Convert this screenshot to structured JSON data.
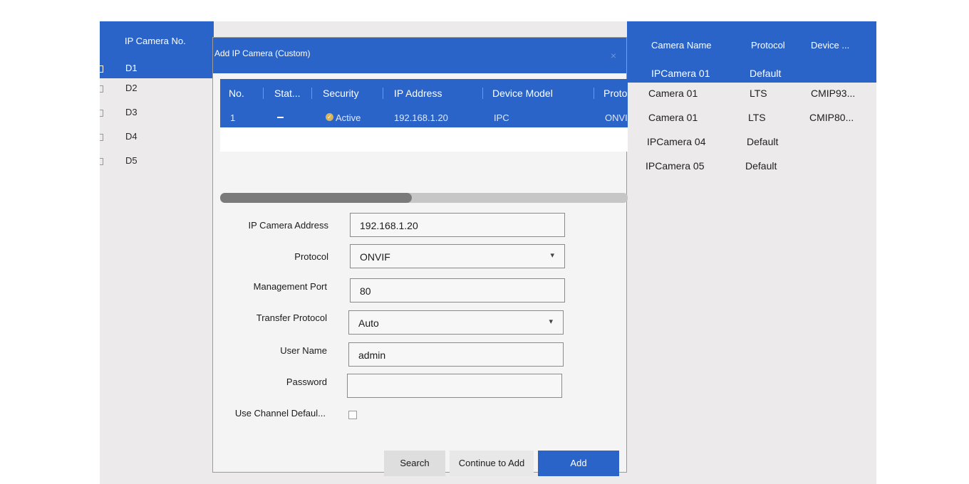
{
  "background": {
    "left_header": "IP Camera No.",
    "left_rows": [
      "D1",
      "D2",
      "D3",
      "D4",
      "D5"
    ],
    "right_headers": [
      "Camera Name",
      "Protocol",
      "Device ..."
    ],
    "right_rows": [
      {
        "camera_name": "IPCamera 01",
        "protocol": "Default",
        "device": ""
      },
      {
        "camera_name": "Camera 01",
        "protocol": "LTS",
        "device": "CMIP93..."
      },
      {
        "camera_name": "Camera 01",
        "protocol": "LTS",
        "device": "CMIP80..."
      },
      {
        "camera_name": "IPCamera 04",
        "protocol": "Default",
        "device": ""
      },
      {
        "camera_name": "IPCamera 05",
        "protocol": "Default",
        "device": ""
      }
    ]
  },
  "dialog": {
    "title": "Add IP Camera (Custom)",
    "close_icon": "×",
    "table": {
      "headers": [
        "No.",
        "Stat...",
        "Security",
        "IP Address",
        "Device Model",
        "Proto"
      ],
      "rows": [
        {
          "no": "1",
          "status": "",
          "security": "Active",
          "ip": "192.168.1.20",
          "model": "IPC",
          "protocol": "ONVI"
        }
      ]
    },
    "scroll_fraction": 0.47,
    "form": {
      "ip_label": "IP Camera Address",
      "ip_value": "192.168.1.20",
      "protocol_label": "Protocol",
      "protocol_value": "ONVIF",
      "mgmt_port_label": "Management Port",
      "mgmt_port_value": "80",
      "transfer_label": "Transfer Protocol",
      "transfer_value": "Auto",
      "user_label": "User Name",
      "user_value": "admin",
      "password_label": "Password",
      "password_value": "",
      "channel_label": "Use Channel Defaul...",
      "channel_checked": false
    },
    "buttons": {
      "search": "Search",
      "continue": "Continue to Add",
      "add": "Add"
    }
  },
  "colors": {
    "accent": "#2a64c8",
    "background": "#eceaeb",
    "security_badge": "#d8b45a"
  },
  "icons": {
    "security": "shield-check-icon",
    "dropdown": "chevron-down-icon",
    "close": "close-icon"
  }
}
